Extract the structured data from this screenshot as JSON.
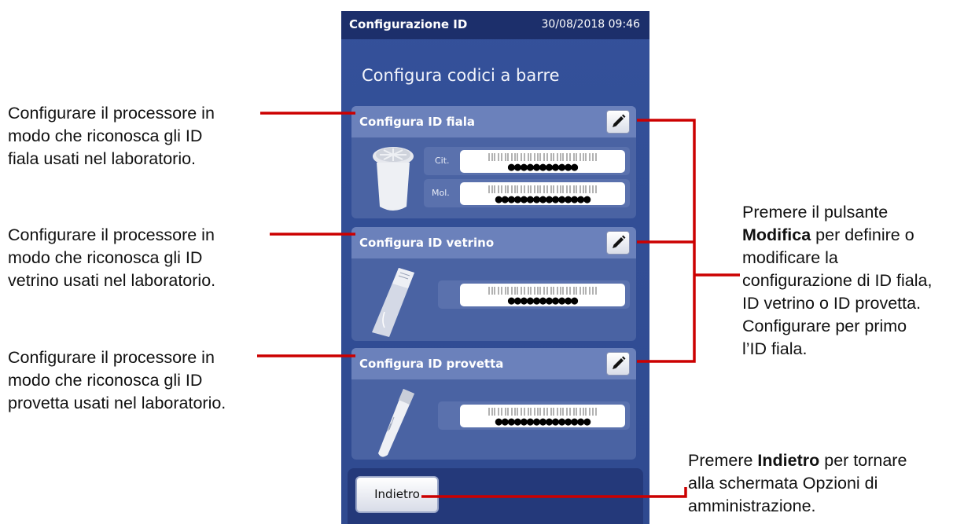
{
  "screen": {
    "title": "Configurazione ID",
    "datetime": "30/08/2018 09:46",
    "heading": "Configura codici a barre",
    "panels": [
      {
        "label": "Configura ID fiala",
        "rows": [
          {
            "prefix": "Cit.",
            "value": "●●●●●●●●●●●"
          },
          {
            "prefix": "Mol.",
            "value": "●●●●●●●●●●●●●●●"
          }
        ]
      },
      {
        "label": "Configura ID vetrino",
        "rows": [
          {
            "prefix": "",
            "value": "●●●●●●●●●●●"
          }
        ]
      },
      {
        "label": "Configura ID provetta",
        "rows": [
          {
            "prefix": "",
            "value": "●●●●●●●●●●●●●●●"
          }
        ]
      }
    ],
    "back_label": "Indietro"
  },
  "annotations": {
    "vial": [
      "Configurare il processore in",
      "modo che riconosca gli ID",
      "fiala usati nel laboratorio."
    ],
    "slide": [
      "Configurare il processore in",
      "modo che riconosca gli ID",
      "vetrino usati nel laboratorio."
    ],
    "tube": [
      "Configurare il processore in",
      "modo che riconosca gli ID",
      "provetta usati nel laboratorio."
    ],
    "edit": {
      "l1": "Premere il pulsante",
      "l2_bold": "Modifica",
      "l2_rest": " per definire o",
      "l3": "modificare la",
      "l4": "configurazione di ID fiala,",
      "l5": "ID vetrino o ID provetta.",
      "l6": "Configurare per primo",
      "l7": "l’ID fiala."
    },
    "back": {
      "l1_pre": "Premere ",
      "l1_bold": "Indietro",
      "l1_rest": " per tornare",
      "l2": "alla schermata Opzioni di",
      "l3": "amministrazione."
    }
  },
  "colors": {
    "callout_line": "#cc0000",
    "title_bar": "#1c2f6b",
    "screen_bg": "#34519a"
  }
}
